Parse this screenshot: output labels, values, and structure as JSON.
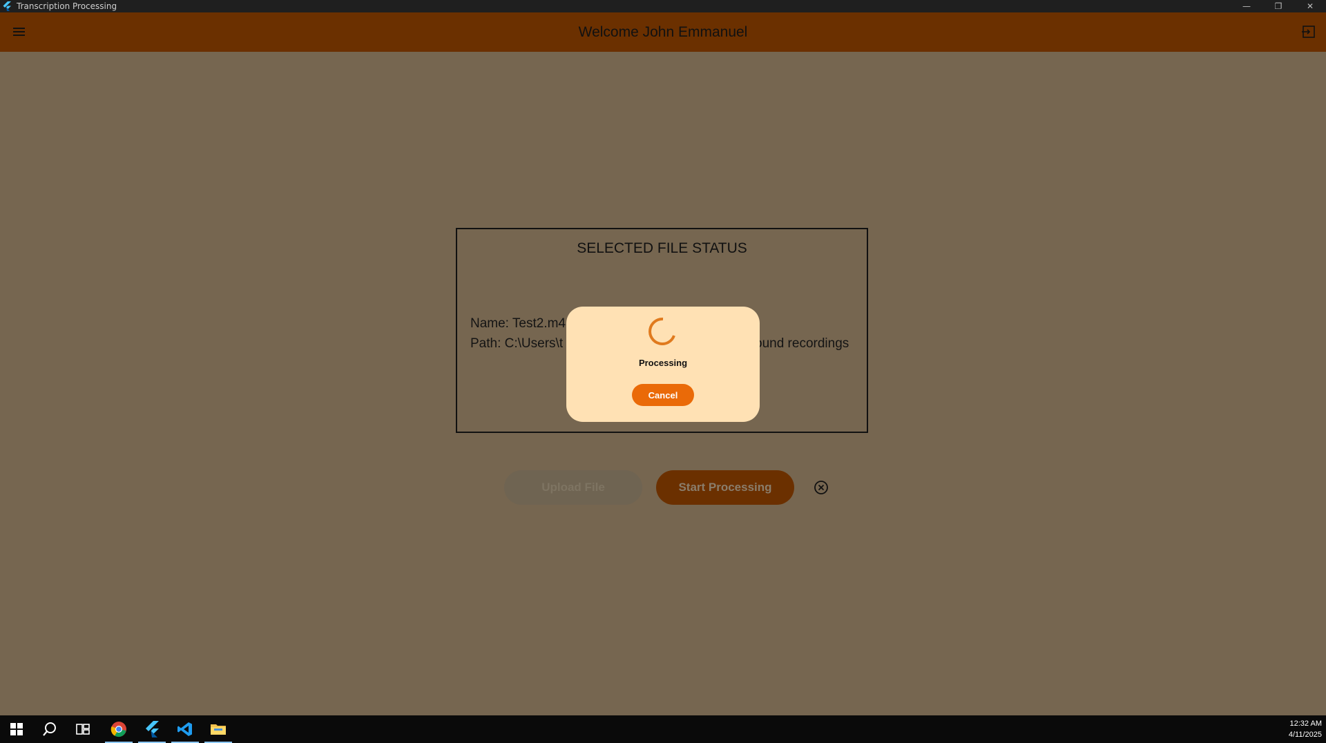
{
  "window": {
    "title": "Transcription Processing",
    "controls": {
      "minimize": "—",
      "maximize": "❐",
      "close": "✕"
    }
  },
  "appbar": {
    "welcome": "Welcome John Emmanuel",
    "menu_icon": "hamburger-menu-icon",
    "logout_icon": "logout-icon"
  },
  "status_card": {
    "heading": "SELECTED FILE STATUS",
    "name_line": "Name: Test2.m4",
    "path_line_left": "Path: C:\\Users\\t",
    "path_line_right": "ound recordings"
  },
  "actions": {
    "upload_label": "Upload File",
    "start_label": "Start Processing",
    "clear_icon": "close-circle-icon"
  },
  "dialog": {
    "status_text": "Processing",
    "cancel_label": "Cancel"
  },
  "taskbar": {
    "apps": [
      "start-icon",
      "search-icon",
      "task-view-icon",
      "chrome-icon",
      "flutter-icon",
      "vscode-icon",
      "file-explorer-icon"
    ],
    "time": "12:32 AM",
    "date": "4/11/2025"
  },
  "colors": {
    "backdrop": "#766650",
    "appbar": "#6b3000",
    "dialog_bg": "#ffe1b4",
    "accent": "#ea6a08"
  }
}
